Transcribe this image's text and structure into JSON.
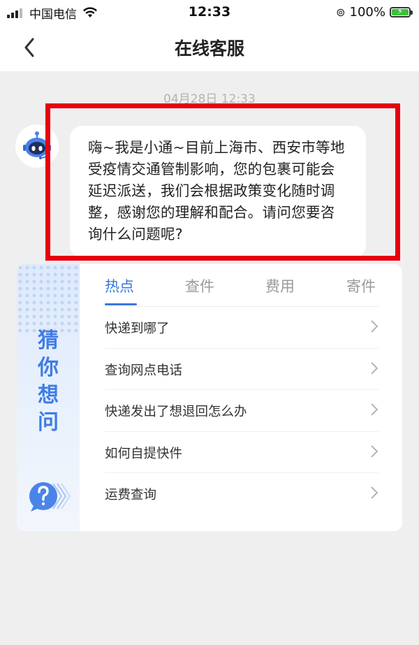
{
  "status_bar": {
    "carrier": "中国电信",
    "time": "12:33",
    "battery": "100%"
  },
  "nav": {
    "title": "在线客服"
  },
  "chat": {
    "timestamp": "04月28日 12:33",
    "message": "嗨~我是小通~目前上海市、西安市等地受疫情交通管制影响，您的包裹可能会延迟派送，我们会根据政策变化随时调整，感谢您的理解和配合。请问您要咨询什么问题呢?"
  },
  "guess_panel": {
    "side_label": [
      "猜",
      "你",
      "想",
      "问"
    ],
    "tabs": [
      {
        "label": "热点",
        "active": true
      },
      {
        "label": "查件",
        "active": false
      },
      {
        "label": "费用",
        "active": false
      },
      {
        "label": "寄件",
        "active": false
      }
    ],
    "questions": [
      "快递到哪了",
      "查询网点电话",
      "快递发出了想退回怎么办",
      "如何自提快件",
      "运费查询"
    ]
  },
  "colors": {
    "accent": "#3a76e0",
    "highlight_border": "#e8000f",
    "background": "#efefef"
  }
}
